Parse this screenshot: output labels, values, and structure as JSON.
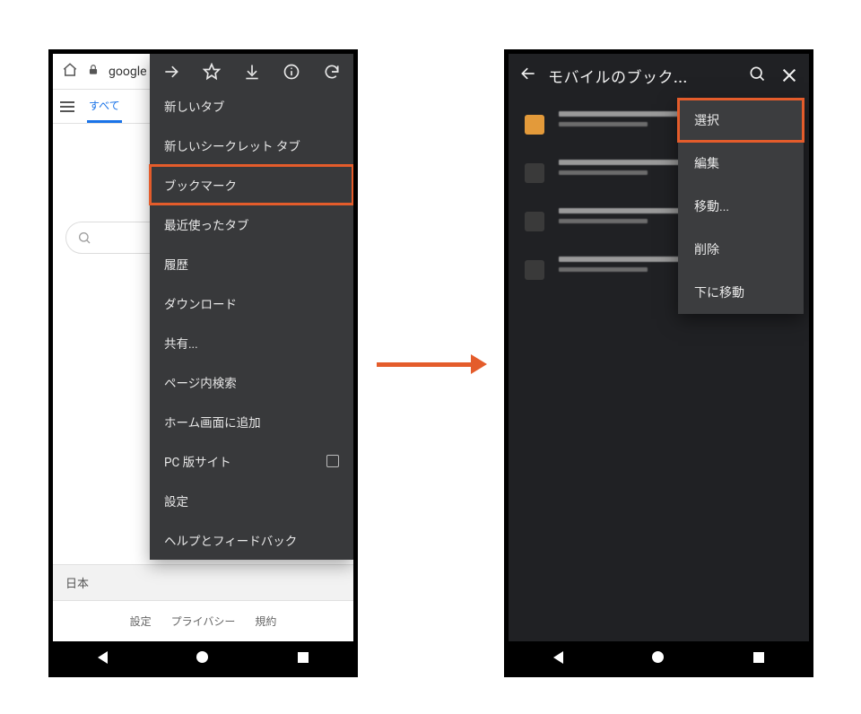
{
  "left": {
    "address": "google",
    "tabs": {
      "all": "すべて"
    },
    "menu_icons": [
      "forward-icon",
      "star-icon",
      "download-icon",
      "info-icon",
      "refresh-icon"
    ],
    "menu_items": [
      "新しいタブ",
      "新しいシークレット タブ",
      "ブックマーク",
      "最近使ったタブ",
      "履歴",
      "ダウンロード",
      "共有...",
      "ページ内検索",
      "ホーム画面に追加",
      "PC 版サイト",
      "設定",
      "ヘルプとフィードバック"
    ],
    "highlight_index": 2,
    "checkbox_index": 9,
    "footer": {
      "country": "日本",
      "links": [
        "設定",
        "プライバシー",
        "規約"
      ]
    }
  },
  "right": {
    "title": "モバイルのブック...",
    "context_items": [
      "選択",
      "編集",
      "移動...",
      "削除",
      "下に移動"
    ],
    "highlight_index": 0,
    "bookmarks_count": 4
  },
  "colors": {
    "highlight": "#e45c2b"
  }
}
